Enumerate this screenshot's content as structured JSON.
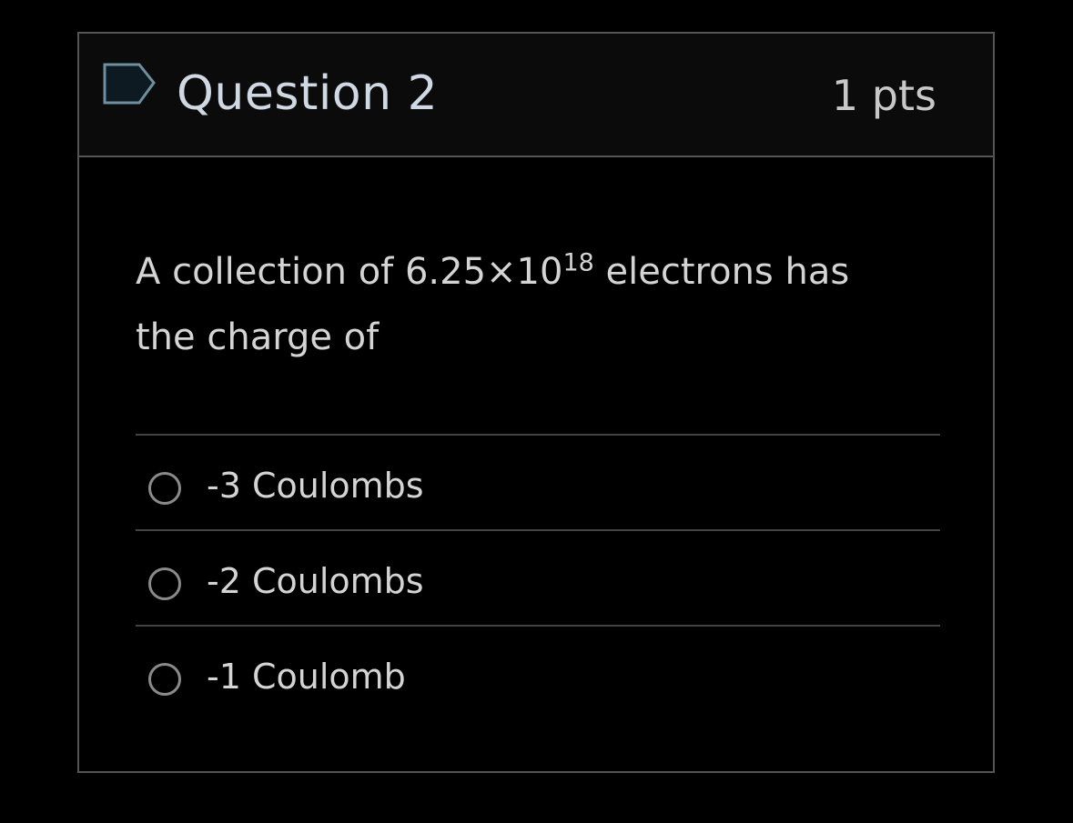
{
  "question": {
    "title": "Question 2",
    "points": "1 pts",
    "text_before": "A collection of 6.25×10",
    "exponent": "18",
    "text_after": " electrons has the charge of",
    "flag_icon": "flag-icon"
  },
  "answers": [
    {
      "label": "-3 Coulombs"
    },
    {
      "label": "-2 Coulombs"
    },
    {
      "label": "-1 Coulomb"
    }
  ],
  "colors": {
    "background": "#000000",
    "header_background": "#0b0b0b",
    "border": "#555555",
    "title": "#cfd8e3",
    "flag_outline": "#6f8fa0"
  }
}
